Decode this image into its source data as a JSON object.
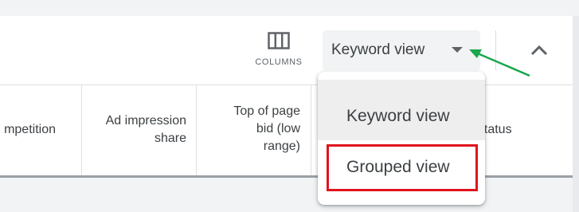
{
  "toolbar": {
    "columns_label": "COLUMNS",
    "columns_icon": "view-column-icon",
    "view_selector_value": "Keyword view",
    "view_selector_icon": "caret-down-icon",
    "collapse_icon": "chevron-up-icon"
  },
  "table": {
    "headers": [
      "mpetition",
      "Ad impression\nshare",
      "Top of page\nbid (low\nrange)",
      "t status"
    ]
  },
  "menu": {
    "options": [
      "Keyword view",
      "Grouped view"
    ],
    "selected": "Keyword view"
  },
  "annotations": {
    "highlight_color": "#e0141e",
    "arrow_color": "#1aa64b",
    "highlighted_option": "Grouped view"
  }
}
